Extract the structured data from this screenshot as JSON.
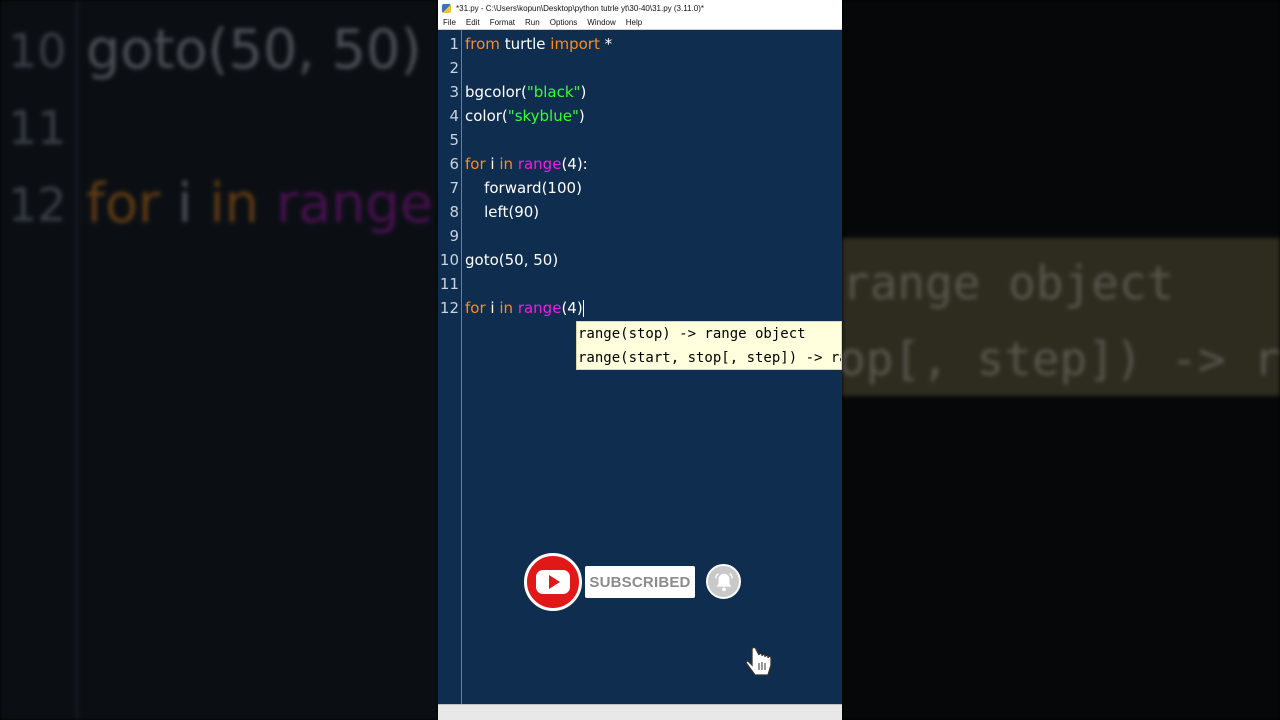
{
  "window": {
    "title": "*31.py - C:\\Users\\kopun\\Desktop\\python tutrle yt\\30-40\\31.py (3.11.0)*",
    "menu": [
      "File",
      "Edit",
      "Format",
      "Run",
      "Options",
      "Window",
      "Help"
    ]
  },
  "editor": {
    "lines": [
      {
        "num": "1",
        "kw1": "from",
        "t1": " turtle ",
        "kw2": "import",
        "t2": " *"
      },
      {
        "num": "2"
      },
      {
        "num": "3",
        "t1": "bgcolor(",
        "s": "\"black\"",
        "t2": ")"
      },
      {
        "num": "4",
        "t1": "color(",
        "s": "\"skyblue\"",
        "t2": ")"
      },
      {
        "num": "5"
      },
      {
        "num": "6",
        "kw1": "for",
        "t1": " i ",
        "kw2": "in",
        "t2": " ",
        "bi": "range",
        "t3": "(4):"
      },
      {
        "num": "7",
        "t1": "    forward(100)"
      },
      {
        "num": "8",
        "t1": "    left(90)"
      },
      {
        "num": "9"
      },
      {
        "num": "10",
        "t1": "goto(50, 50)"
      },
      {
        "num": "11"
      },
      {
        "num": "12",
        "kw1": "for",
        "t1": " i ",
        "kw2": "in",
        "t2": " ",
        "bi": "range",
        "t3": "(4)"
      }
    ],
    "calltip": [
      "range(stop) -> range object",
      "range(start, stop[, step]) -> range object"
    ]
  },
  "background": {
    "left_nums": [
      "10",
      "11",
      "12"
    ],
    "left_line10": "goto(50, 50)",
    "left_line12_kw1": "for",
    "left_line12_t": " i ",
    "left_line12_kw2": "in",
    "left_line12_bi": " range(",
    "right_tip1": "range object",
    "right_tip2": "op[, step]) -> ran"
  },
  "overlay": {
    "subscribe_label": "SUBSCRIBED",
    "icons": [
      "youtube-icon",
      "bell-icon",
      "hand-cursor-icon"
    ],
    "youtube_color": "#e01818"
  },
  "colors": {
    "editor_bg": "#0f2d4e",
    "keyword": "#ff8c1a",
    "string": "#33ff33",
    "builtin": "#ee1ee9",
    "calltip_bg": "#ffffdd"
  }
}
